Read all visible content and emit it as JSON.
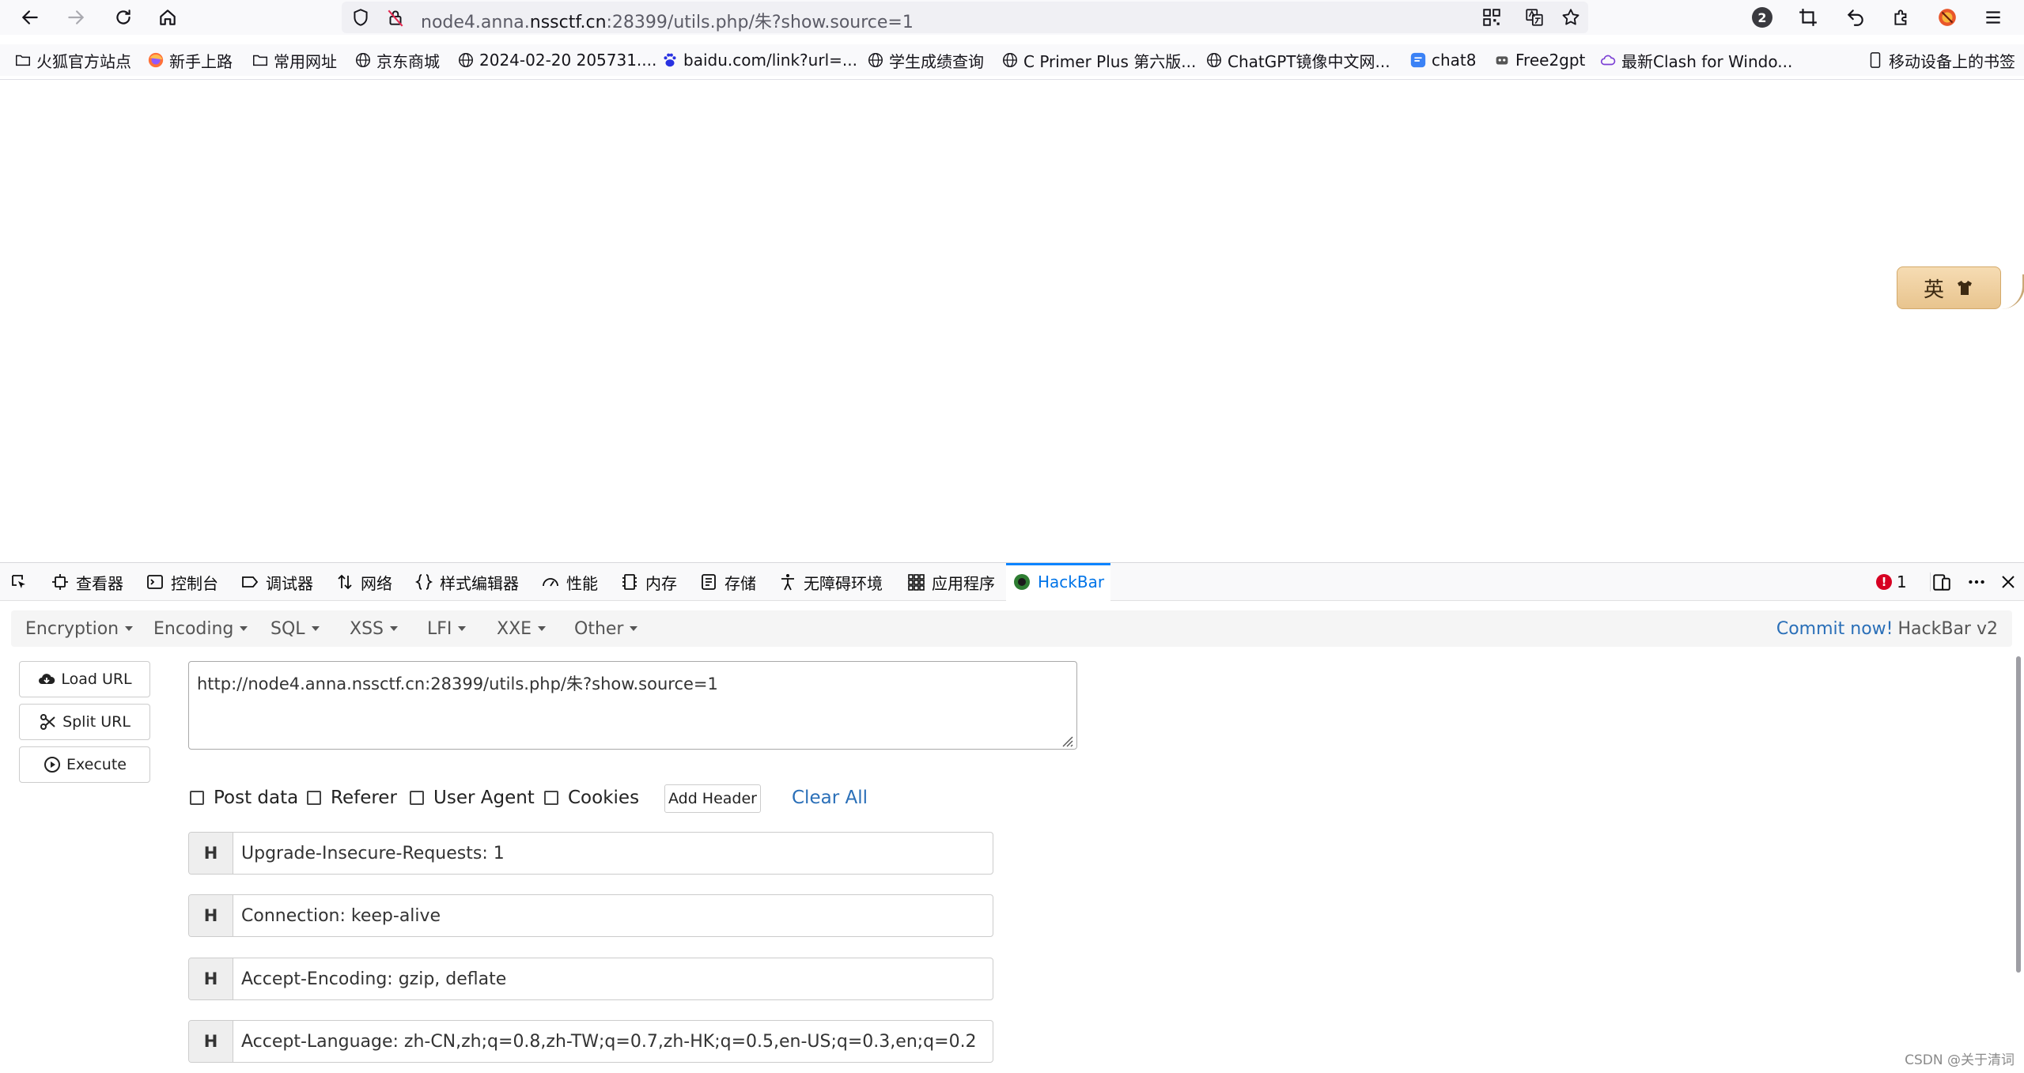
{
  "browser": {
    "url_prefix": "node4.anna.",
    "url_host": "nssctf.cn",
    "url_suffix": ":28399/utils.php/朱?show.source=1",
    "badge_count": "2"
  },
  "bookmarks": [
    {
      "label": "火狐官方站点",
      "icon": "folder-icon"
    },
    {
      "label": "新手上路",
      "icon": "firefox-icon"
    },
    {
      "label": "常用网址",
      "icon": "folder-icon"
    },
    {
      "label": "京东商城",
      "icon": "globe-icon"
    },
    {
      "label": "2024-02-20 205731....",
      "icon": "globe-icon"
    },
    {
      "label": "baidu.com/link?url=...",
      "icon": "baidu-icon"
    },
    {
      "label": "学生成绩查询",
      "icon": "globe-icon"
    },
    {
      "label": "C Primer Plus 第六版...",
      "icon": "globe-icon"
    },
    {
      "label": "ChatGPT镜像中文网...",
      "icon": "globe-icon"
    },
    {
      "label": "chat8",
      "icon": "chat-icon"
    },
    {
      "label": "Free2gpt",
      "icon": "bot-icon"
    },
    {
      "label": "最新Clash for Windo...",
      "icon": "cloud-icon"
    },
    {
      "label": "移动设备上的书签",
      "icon": "mobile-icon"
    }
  ],
  "page": {
    "widget_char": "英"
  },
  "devtools": {
    "tabs": [
      {
        "label": "查看器",
        "icon": "inspector-icon"
      },
      {
        "label": "控制台",
        "icon": "console-icon"
      },
      {
        "label": "调试器",
        "icon": "debugger-icon"
      },
      {
        "label": "网络",
        "icon": "network-icon"
      },
      {
        "label": "样式编辑器",
        "icon": "style-editor-icon"
      },
      {
        "label": "性能",
        "icon": "performance-icon"
      },
      {
        "label": "内存",
        "icon": "memory-icon"
      },
      {
        "label": "存储",
        "icon": "storage-icon"
      },
      {
        "label": "无障碍环境",
        "icon": "accessibility-icon"
      },
      {
        "label": "应用程序",
        "icon": "application-icon"
      },
      {
        "label": "HackBar",
        "icon": "hackbar-icon"
      }
    ],
    "error_count": "1"
  },
  "hackbar": {
    "menus": [
      "Encryption",
      "Encoding",
      "SQL",
      "XSS",
      "LFI",
      "XXE",
      "Other"
    ],
    "commit_link": "Commit now!",
    "version": "HackBar v2",
    "buttons": {
      "load_url": "Load URL",
      "split_url": "Split URL",
      "execute": "Execute"
    },
    "url_value": "http://node4.anna.nssctf.cn:28399/utils.php/朱?show.source=1",
    "options": [
      "Post data",
      "Referer",
      "User Agent",
      "Cookies"
    ],
    "add_header": "Add Header",
    "clear_all": "Clear All",
    "header_label": "H",
    "headers": [
      "Upgrade-Insecure-Requests: 1",
      "Connection: keep-alive",
      "Accept-Encoding: gzip, deflate",
      "Accept-Language: zh-CN,zh;q=0.8,zh-TW;q=0.7,zh-HK;q=0.5,en-US;q=0.3,en;q=0.2"
    ]
  },
  "watermark": "CSDN @关于清词"
}
